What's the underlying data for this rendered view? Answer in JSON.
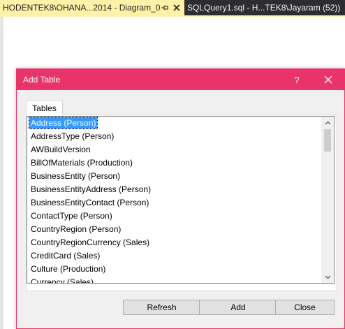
{
  "tabs": {
    "active_label": "HODENTEK8\\OHANA...2014 - Diagram_0",
    "inactive_label": "SQLQuery1.sql - H...TEK8\\Jayaram (52))"
  },
  "dialog": {
    "title": "Add Table",
    "help_label": "?",
    "tab_label": "Tables",
    "items": [
      "Address (Person)",
      "AddressType (Person)",
      "AWBuildVersion",
      "BillOfMaterials (Production)",
      "BusinessEntity (Person)",
      "BusinessEntityAddress (Person)",
      "BusinessEntityContact (Person)",
      "ContactType (Person)",
      "CountryRegion (Person)",
      "CountryRegionCurrency (Sales)",
      "CreditCard (Sales)",
      "Culture (Production)",
      "Currency (Sales)"
    ],
    "selected_index": 0,
    "buttons": {
      "refresh": "Refresh",
      "add": "Add",
      "close": "Close"
    }
  },
  "colors": {
    "accent": "#e8336b",
    "active_tab": "#fff1a8",
    "selection": "#3399ff"
  },
  "icons": {
    "pin": "pin-icon",
    "tab_close": "close-icon",
    "dialog_close": "close-icon",
    "scroll_up": "chevron-up-icon",
    "scroll_down": "chevron-down-icon"
  }
}
